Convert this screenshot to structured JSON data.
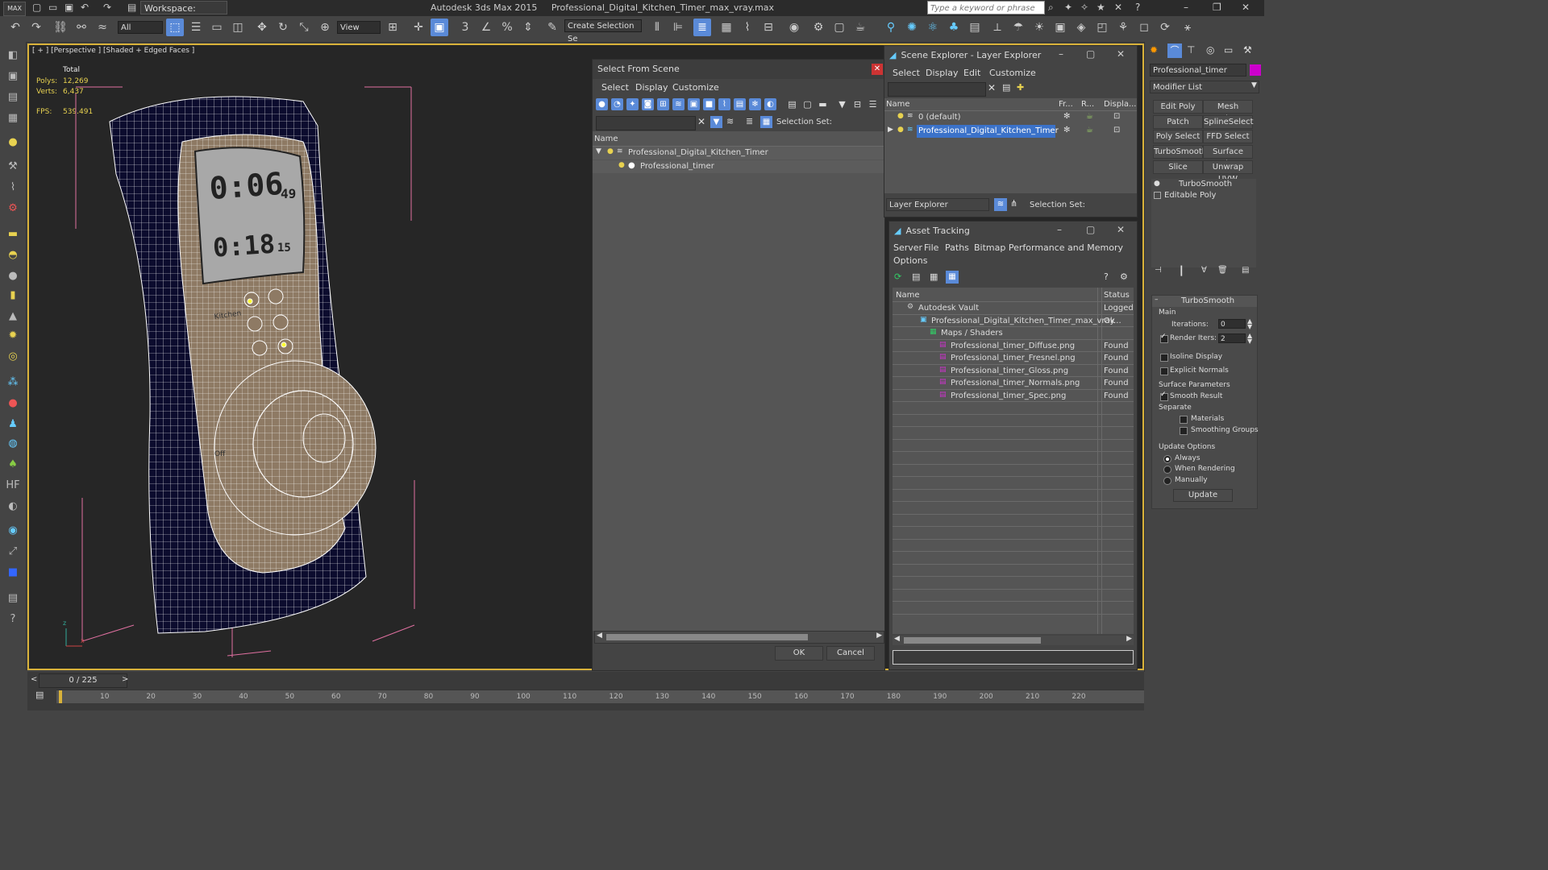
{
  "title_bar": {
    "app_title": "Autodesk 3ds Max  2015",
    "file_name": "Professional_Digital_Kitchen_Timer_max_vray.max",
    "workspace": "Workspace: Default",
    "search_placeholder": "Type a keyword or phrase"
  },
  "toolbar": {
    "filter_value": "All",
    "ref_coord": "View",
    "selection_set_placeholder": "Create Selection Se",
    "snap_label": "3"
  },
  "viewport": {
    "label": "[ + ] [Perspective ] [Shaded + Edged Faces ]",
    "stats_total": "Total",
    "polys_label": "Polys:",
    "polys_value": "12,269",
    "verts_label": "Verts:",
    "verts_value": "6,437",
    "fps_label": "FPS:",
    "fps_value": "539.491",
    "lcd_top": "0:06",
    "lcd_top_sec": "49",
    "lcd_bottom": "0:18",
    "lcd_bottom_sec": "15",
    "brand": "Kitchen",
    "knob_label": "Off"
  },
  "select_from_scene": {
    "title": "Select From Scene",
    "menus": [
      "Select",
      "Display",
      "Customize"
    ],
    "selection_set_label": "Selection Set:",
    "column_name": "Name",
    "tree": [
      "Professional_Digital_Kitchen_Timer",
      "Professional_timer"
    ],
    "ok": "OK",
    "cancel": "Cancel"
  },
  "scene_explorer": {
    "title": "Scene Explorer - Layer Explorer",
    "menus": [
      "Select",
      "Display",
      "Edit",
      "Customize"
    ],
    "columns": [
      "Name",
      "Fr...",
      "R...",
      "Displa..."
    ],
    "layers": [
      "0 (default)",
      "Professional_Digital_Kitchen_Timer"
    ],
    "footer_dropdown": "Layer Explorer",
    "selection_set_label": "Selection Set:"
  },
  "asset_tracking": {
    "title": "Asset Tracking",
    "menus": [
      "Server",
      "File",
      "Paths",
      "Bitmap Performance and Memory",
      "Options"
    ],
    "columns": [
      "Name",
      "Status"
    ],
    "rows": [
      {
        "name": "Autodesk Vault",
        "status": "Logged"
      },
      {
        "name": "Professional_Digital_Kitchen_Timer_max_vray...",
        "status": "Ok"
      },
      {
        "name": "Maps / Shaders",
        "status": ""
      },
      {
        "name": "Professional_timer_Diffuse.png",
        "status": "Found"
      },
      {
        "name": "Professional_timer_Fresnel.png",
        "status": "Found"
      },
      {
        "name": "Professional_timer_Gloss.png",
        "status": "Found"
      },
      {
        "name": "Professional_timer_Normals.png",
        "status": "Found"
      },
      {
        "name": "Professional_timer_Spec.png",
        "status": "Found"
      }
    ]
  },
  "command_panel": {
    "object_name": "Professional_timer",
    "modifier_list": "Modifier List",
    "buttons": [
      "Edit Poly",
      "Mesh Select",
      "Patch Select",
      "SplineSelect",
      "Poly Select",
      "FFD Select",
      "TurboSmooth",
      "Surface Select",
      "Slice",
      "Unwrap UVW"
    ],
    "stack": [
      "TurboSmooth",
      "Editable Poly"
    ],
    "rollout_title": "TurboSmooth",
    "main_label": "Main",
    "iterations_label": "Iterations:",
    "iterations_value": "0",
    "render_iters_label": "Render Iters:",
    "render_iters_value": "2",
    "isoline_display": "Isoline Display",
    "explicit_normals": "Explicit Normals",
    "surface_params": "Surface Parameters",
    "smooth_result": "Smooth Result",
    "separate": "Separate",
    "materials": "Materials",
    "smoothing_groups": "Smoothing Groups",
    "update_options": "Update Options",
    "always": "Always",
    "when_rendering": "When Rendering",
    "manually": "Manually",
    "update_button": "Update"
  },
  "timeline": {
    "frame": "0 / 225",
    "ticks": [
      "10",
      "20",
      "30",
      "40",
      "50",
      "60",
      "70",
      "80",
      "90",
      "100",
      "110",
      "120",
      "130",
      "140",
      "150",
      "160",
      "170",
      "180",
      "190",
      "200",
      "210",
      "220"
    ]
  }
}
